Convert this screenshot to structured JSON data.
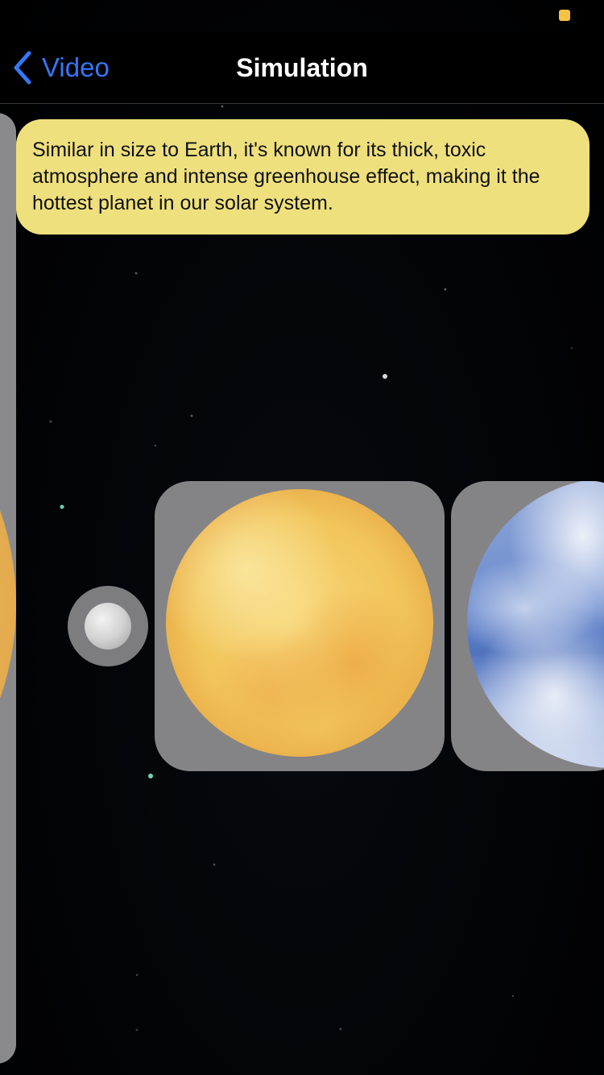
{
  "status_bar": {
    "indicator_color": "#f5c242"
  },
  "nav": {
    "back_label": "Video",
    "title": "Simulation",
    "accent_color": "#3478f6"
  },
  "tooltip": {
    "text": "Similar in size to Earth, it's known for its thick, toxic atmosphere and intense greenhouse effect, making it the hottest planet in our solar system.",
    "background_color": "#efe07e"
  },
  "carousel": {
    "items": [
      {
        "icon": "sun-icon",
        "state": "partially-visible"
      },
      {
        "icon": "moon-icon",
        "state": "small"
      },
      {
        "icon": "venus-icon",
        "state": "selected"
      },
      {
        "icon": "earth-icon",
        "state": "partially-visible"
      }
    ]
  }
}
